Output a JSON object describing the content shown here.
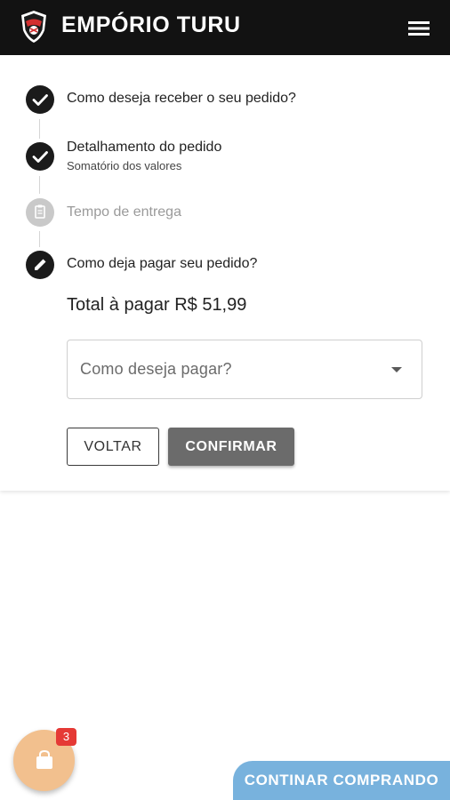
{
  "header": {
    "brand": "EMPÓRIO TURU",
    "logo_icon": "club-crest-logo",
    "menu_icon": "hamburger-menu-icon"
  },
  "steps": [
    {
      "title": "Como deseja receber o seu pedido?",
      "subtitle": "",
      "status": "done",
      "icon": "check-icon"
    },
    {
      "title": "Detalhamento do pedido",
      "subtitle": "Somatório dos valores",
      "status": "done",
      "icon": "check-icon"
    },
    {
      "title": "Tempo de entrega",
      "subtitle": "",
      "status": "pending",
      "icon": "clipboard-icon"
    },
    {
      "title": "Como deja pagar seu pedido?",
      "subtitle": "",
      "status": "active",
      "icon": "pencil-icon"
    }
  ],
  "payment": {
    "total_label": "Total à pagar R$ 51,99",
    "select_placeholder": "Como deseja pagar?",
    "caret_icon": "dropdown-caret-icon"
  },
  "buttons": {
    "back": "VOLTAR",
    "confirm": "CONFIRMAR"
  },
  "cart": {
    "count": "3",
    "icon": "shopping-bag-icon",
    "continue_label": "CONTINAR COMPRANDO"
  },
  "colors": {
    "appbar": "#121212",
    "step_done": "#1b1b1b",
    "step_pending": "#c9c9c9",
    "confirm_button": "#6b6b6b",
    "cart_fab": "#f2c08e",
    "badge": "#e53935",
    "continue_button": "#78b2dd"
  }
}
